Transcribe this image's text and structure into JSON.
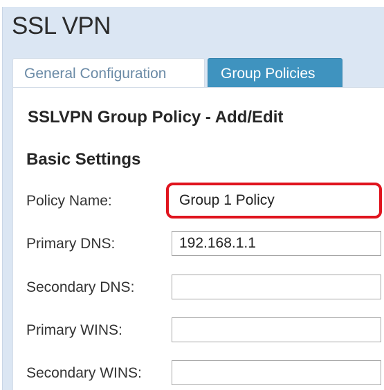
{
  "page": {
    "title": "SSL VPN"
  },
  "tabs": [
    {
      "label": "General Configuration",
      "active": false
    },
    {
      "label": "Group Policies",
      "active": true
    }
  ],
  "form": {
    "title": "SSLVPN Group Policy - Add/Edit",
    "section_title": "Basic Settings",
    "fields": [
      {
        "label": "Policy Name:",
        "value": "Group 1 Policy",
        "highlighted": true
      },
      {
        "label": "Primary DNS:",
        "value": "192.168.1.1"
      },
      {
        "label": "Secondary DNS:",
        "value": ""
      },
      {
        "label": "Primary WINS:",
        "value": ""
      },
      {
        "label": "Secondary WINS:",
        "value": ""
      }
    ]
  },
  "colors": {
    "header_bg": "#dbe6f3",
    "active_tab": "#3f93bf",
    "inactive_tab_text": "#6a8aa6",
    "highlight": "#e0141e"
  }
}
